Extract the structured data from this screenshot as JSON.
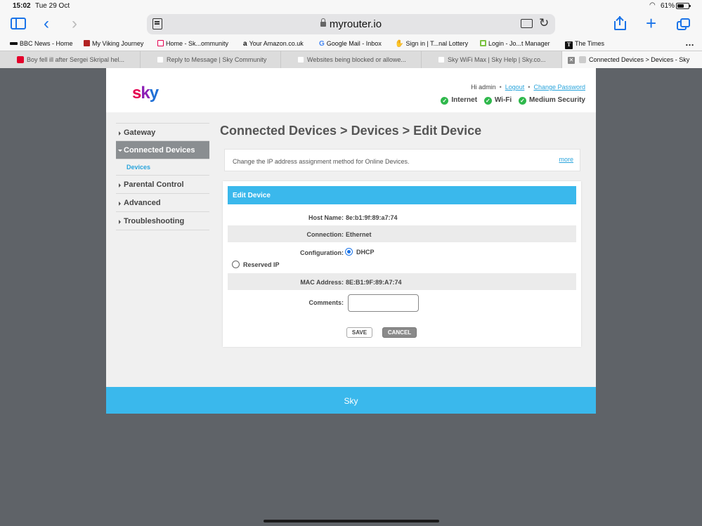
{
  "status_bar": {
    "time": "15:02",
    "date": "Tue 29 Oct",
    "battery": "61%",
    "battery_level": 0.61
  },
  "toolbar": {
    "url": "myrouter.io"
  },
  "bookmarks": [
    {
      "label": "BBC News - Home",
      "icon": "bbc-icon",
      "color": "#111111"
    },
    {
      "label": "My Viking Journey",
      "icon": "viking-icon",
      "color": "#b22222"
    },
    {
      "label": "Home - Sk...ommunity",
      "icon": "sky-icon",
      "color": "#e4004f"
    },
    {
      "label": "Your Amazon.co.uk",
      "icon": "amazon-icon",
      "color": "#111111"
    },
    {
      "label": "Google Mail - Inbox",
      "icon": "google-icon",
      "color": "#4285f4"
    },
    {
      "label": "Sign in | T...nal Lottery",
      "icon": "lottery-icon",
      "color": "#7b5ea7"
    },
    {
      "label": "Login - Jo...t Manager",
      "icon": "login-icon",
      "color": "#7cc242"
    },
    {
      "label": "The Times",
      "icon": "times-icon",
      "color": "#111111"
    }
  ],
  "tabs": [
    {
      "label": "Boy fell ill after Sergei Skripal hel...",
      "active": false
    },
    {
      "label": "Reply to Message | Sky Community",
      "active": false
    },
    {
      "label": "Websites being blocked or allowe...",
      "active": false
    },
    {
      "label": "Sky WiFi Max | Sky Help | Sky.co...",
      "active": false
    },
    {
      "label": "Connected Devices > Devices - Sky",
      "active": true
    }
  ],
  "header": {
    "logo": [
      "s",
      "k",
      "y"
    ],
    "greeting": "Hi admin",
    "logout": "Logout",
    "change_password": "Change Password",
    "status": [
      "Internet",
      "Wi-Fi",
      "Medium Security"
    ],
    "status_color": "#2fb84c"
  },
  "nav": {
    "gateway": "Gateway",
    "connected_devices": "Connected Devices",
    "devices": "Devices",
    "parental_control": "Parental Control",
    "advanced": "Advanced",
    "troubleshooting": "Troubleshooting"
  },
  "main": {
    "title": "Connected Devices > Devices > Edit Device",
    "info_text": "Change the IP address assignment method for Online Devices.",
    "more": "more"
  },
  "edit_device": {
    "header": "Edit Device",
    "host_name_label": "Host Name:",
    "host_name": "8e:b1:9f:89:a7:74",
    "connection_label": "Connection:",
    "connection": "Ethernet",
    "configuration_label": "Configuration:",
    "dhcp": "DHCP",
    "reserved_ip": "Reserved IP",
    "selected": "DHCP",
    "mac_label": "MAC Address:",
    "mac": "8E:B1:9F:89:A7:74",
    "comments_label": "Comments:",
    "comments_value": "",
    "save": "SAVE",
    "cancel": "CANCEL"
  },
  "footer": {
    "text": "Sky"
  },
  "colors": {
    "accent": "#3ab8ec",
    "link": "#29a4dc",
    "nav_active": "#8a8e91"
  }
}
